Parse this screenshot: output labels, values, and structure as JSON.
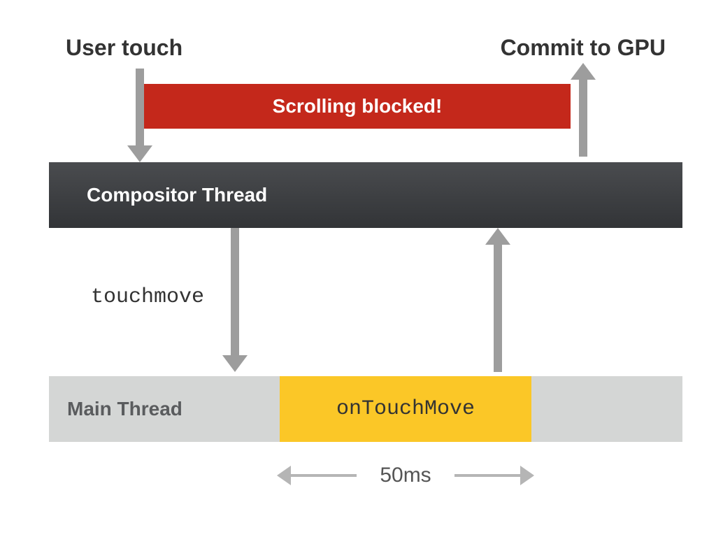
{
  "top": {
    "user_touch": "User touch",
    "commit_gpu": "Commit to GPU"
  },
  "banner": {
    "text": "Scrolling blocked!"
  },
  "compositor": {
    "label": "Compositor Thread"
  },
  "events": {
    "touchmove": "touchmove"
  },
  "main_thread": {
    "label": "Main Thread",
    "handler": "onTouchMove"
  },
  "dimension": {
    "label": "50ms"
  },
  "colors": {
    "banner": "#c4281b",
    "compositor_top": "#4a4c4f",
    "compositor_bottom": "#323437",
    "mainthread_bg": "#d4d6d5",
    "handler_bg": "#fbc727",
    "arrow": "#9d9d9d"
  }
}
